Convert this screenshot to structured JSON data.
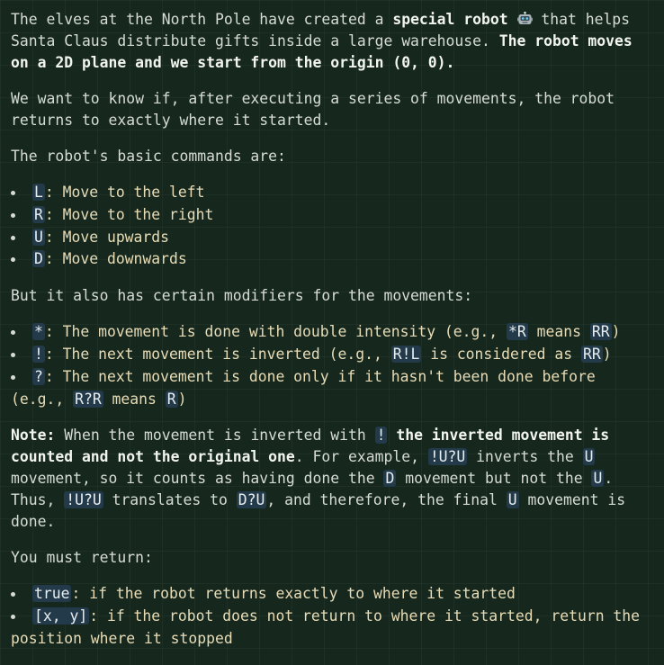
{
  "intro": {
    "t1": "The elves at the North Pole have created a ",
    "bold1": "special robot",
    "icon": "robot-emoji-icon",
    "t2": " that helps Santa Claus distribute gifts inside a large warehouse. ",
    "bold2": "The robot moves on a 2D plane and we start from the origin (0, 0)."
  },
  "goal": "We want to know if, after executing a series of movements, the robot returns to exactly where it started.",
  "commands_heading": "The robot's basic commands are:",
  "commands": [
    {
      "code": "L",
      "text": ": Move to the left"
    },
    {
      "code": "R",
      "text": ": Move to the right"
    },
    {
      "code": "U",
      "text": ": Move upwards"
    },
    {
      "code": "D",
      "text": ": Move downwards"
    }
  ],
  "modifiers_heading": "But it also has certain modifiers for the movements:",
  "modifiers": [
    {
      "code": "*",
      "t1": ": The movement is done with double intensity (e.g., ",
      "ex1": "*R",
      "t2": " means ",
      "ex2": "RR",
      "t3": ")"
    },
    {
      "code": "!",
      "t1": ": The next movement is inverted (e.g., ",
      "ex1": "R!L",
      "t2": " is considered as ",
      "ex2": "RR",
      "t3": ")"
    },
    {
      "code": "?",
      "t1": ": The next movement is done only if it hasn't been done before (e.g., ",
      "ex1": "R?R",
      "t2": " means ",
      "ex2": "R",
      "t3": ")"
    }
  ],
  "note": {
    "label": "Note:",
    "t1": " When the movement is inverted with ",
    "c1": "!",
    "bold": " the inverted movement is counted and not the original one",
    "t2": ". For example, ",
    "c2": "!U?U",
    "t3": " inverts the ",
    "c3": "U",
    "t4": " movement, so it counts as having done the ",
    "c4": "D",
    "t5": " movement but not the ",
    "c5": "U",
    "t6": ". Thus, ",
    "c6": "!U?U",
    "t7": " translates to ",
    "c7": "D?U",
    "t8": ", and therefore, the final ",
    "c8": "U",
    "t9": " movement is done."
  },
  "return_heading": "You must return:",
  "returns": [
    {
      "code": "true",
      "text": ": if the robot returns exactly to where it started"
    },
    {
      "code": "[x, y]",
      "text": ": if the robot does not return to where it started, return the position where it stopped"
    }
  ],
  "colors": {
    "background": "#16271e",
    "body_text": "#d6dcd4",
    "list_text": "#e7dcb6",
    "code_background": "#223a49"
  }
}
